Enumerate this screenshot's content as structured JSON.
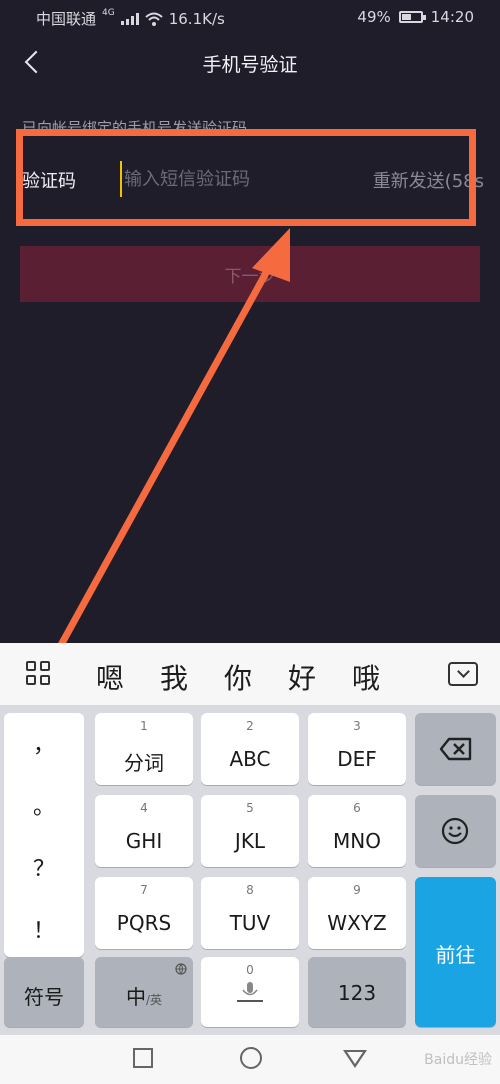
{
  "status_bar": {
    "carrier": "中国联通",
    "network": "4G",
    "speed": "16.1K/s",
    "battery_percent": "49%",
    "battery_level": 0.49,
    "time": "14:20"
  },
  "header": {
    "title": "手机号验证"
  },
  "form": {
    "hint": "已向帐号绑定的手机号发送验证码",
    "code_label": "验证码",
    "code_placeholder": "输入短信验证码",
    "code_value": "",
    "resend_label": "重新发送(58s",
    "next_label": "下一步"
  },
  "candidates": [
    "嗯",
    "我",
    "你",
    "好",
    "哦"
  ],
  "keyboard": {
    "punctuation": [
      "，",
      "。",
      "？",
      "！"
    ],
    "keys": [
      {
        "num": "1",
        "label": "分词"
      },
      {
        "num": "2",
        "label": "ABC"
      },
      {
        "num": "3",
        "label": "DEF"
      },
      {
        "num": "4",
        "label": "GHI"
      },
      {
        "num": "5",
        "label": "JKL"
      },
      {
        "num": "6",
        "label": "MNO"
      },
      {
        "num": "7",
        "label": "PQRS"
      },
      {
        "num": "8",
        "label": "TUV"
      },
      {
        "num": "9",
        "label": "WXYZ"
      }
    ],
    "symbols_label": "符号",
    "lang_label": "中",
    "lang_sub": "/英",
    "space_num": "0",
    "num_label": "123",
    "enter_label": "前往"
  },
  "watermark": "Baidu经验",
  "colors": {
    "background": "#1f1d2a",
    "accent_highlight": "#f56a3f",
    "button_disabled": "#5a1f33",
    "enter_key": "#1aa4e4"
  },
  "icons": [
    "back-chevron-icon",
    "grid-icon",
    "hide-keyboard-icon",
    "backspace-icon",
    "emoji-icon",
    "microphone-icon",
    "globe-icon"
  ]
}
